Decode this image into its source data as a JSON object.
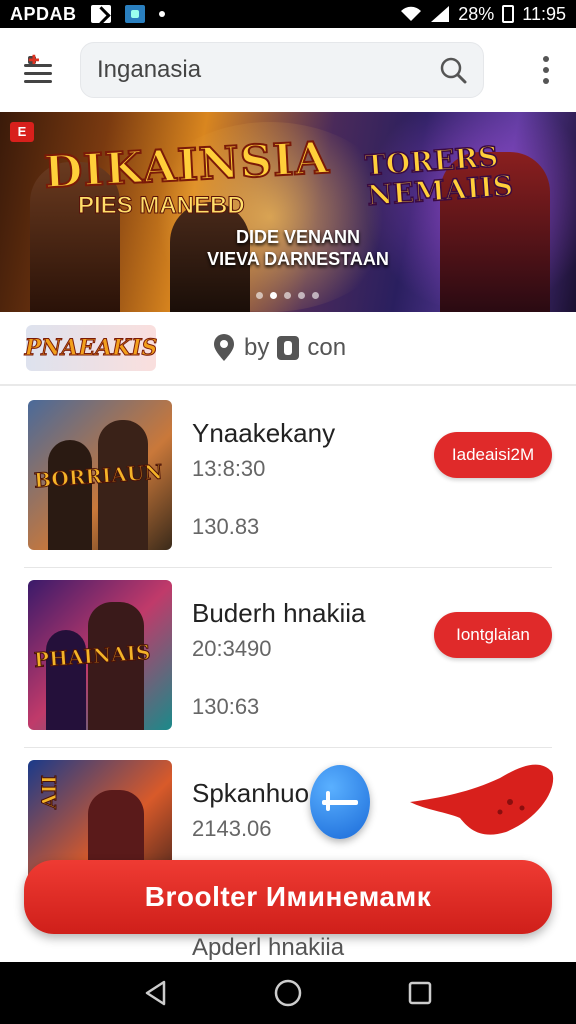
{
  "status_bar": {
    "carrier": "APDAB",
    "battery": "28%",
    "time": "11:95"
  },
  "search": {
    "query": "Inganasia"
  },
  "banner": {
    "badge": "E",
    "title_left": "DIKAINSIA",
    "subtitle_left": "PIES MANEBD",
    "title_right": "TORERS NEMAIIS",
    "caption_line1": "DIDE VENANN",
    "caption_line2": "VIEVA DARNESTAAN",
    "pages": 5,
    "active_page": 1
  },
  "subheader": {
    "brand_logo": "PNAEAKIS",
    "by_label": "by",
    "by_name": "con"
  },
  "list": [
    {
      "title": "Ynaakekany",
      "meta1": "13:8:30",
      "meta2": "130.83",
      "button": "Iadeaisi2M",
      "thumb_label": "BORRIAUN"
    },
    {
      "title": "Buderh hnakiia",
      "meta1": "20:3490",
      "meta2": "130:63",
      "button": "Iontglaian",
      "thumb_label": "PHAINAIS"
    },
    {
      "title": "Spkanhuo fine",
      "meta1": "2143.06",
      "meta2": "",
      "button": "",
      "thumb_label": "AII"
    }
  ],
  "cta": {
    "label": "Broolter Иминемамк"
  },
  "peek": {
    "title": "Apderl hnakiia"
  },
  "colors": {
    "accent": "#e02a2a",
    "fab": "#1a6ad8"
  }
}
